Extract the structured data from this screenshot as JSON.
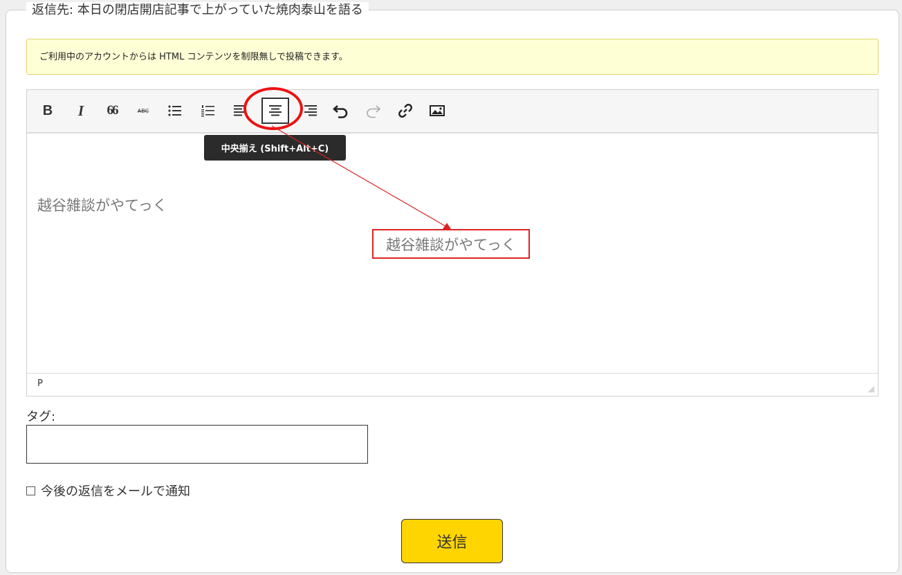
{
  "reply": {
    "legend": "返信先: 本日の閉店開店記事で上がっていた焼肉泰山を語る"
  },
  "notice": {
    "text": "ご利用中のアカウントからは HTML コンテンツを制限無しで投稿できます。"
  },
  "toolbar": {
    "bold_label": "B",
    "italic_label": "I",
    "quote_label": "66",
    "strike_label": "ABC",
    "tooltip": "中央揃え (Shift+Alt+C)",
    "icons": [
      "bold-icon",
      "italic-icon",
      "blockquote-icon",
      "strikethrough-icon",
      "bullet-list-icon",
      "numbered-list-icon",
      "align-left-icon",
      "align-center-icon",
      "align-right-icon",
      "undo-icon",
      "redo-icon",
      "link-icon",
      "image-icon"
    ]
  },
  "editor": {
    "content": "越谷雑談がやてっく",
    "path": "P"
  },
  "annotation": {
    "preview_text": "越谷雑談がやてっく",
    "color": "#dd1111"
  },
  "form": {
    "tag_label": "タグ:",
    "tag_value": "",
    "notify_label": "今後の返信をメールで通知",
    "submit_label": "送信"
  },
  "colors": {
    "accent": "#ffd500",
    "notice_bg": "#ffffd6",
    "tooltip_bg": "#2b2b2b"
  }
}
